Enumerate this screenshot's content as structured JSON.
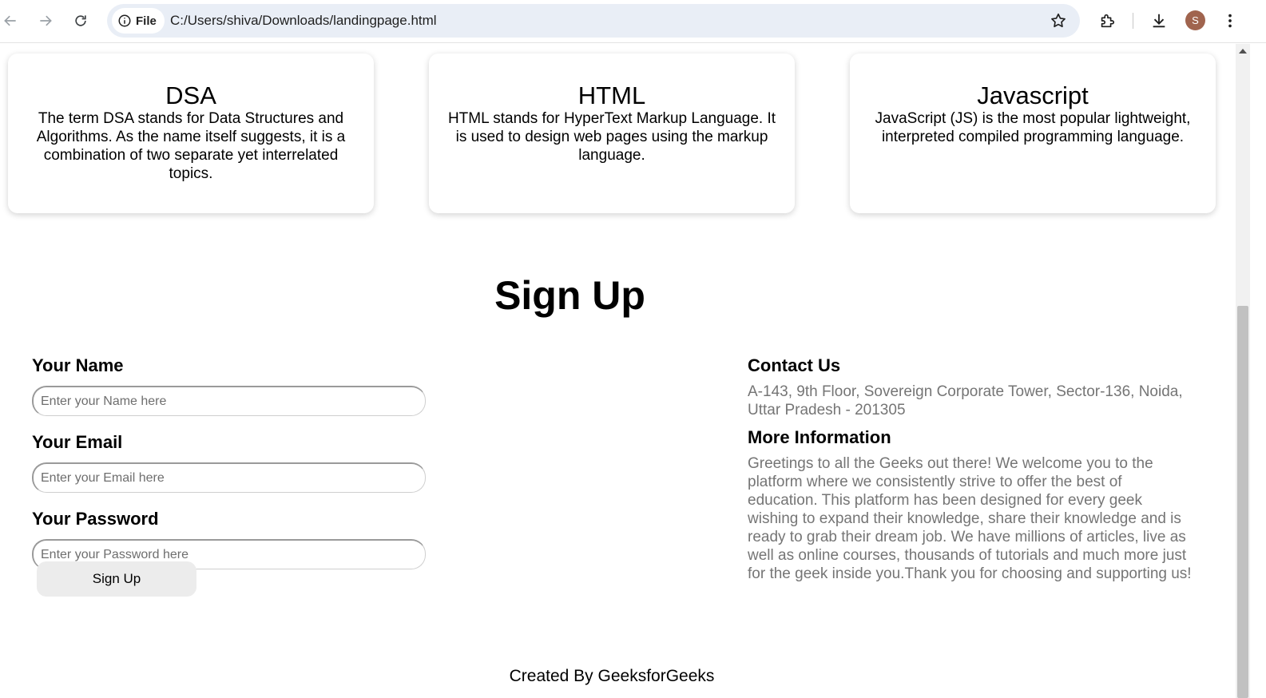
{
  "browser": {
    "site_chip_label": "File",
    "url": "C:/Users/shiva/Downloads/landingpage.html",
    "avatar_letter": "S",
    "avatar_color": "#a0644e"
  },
  "cards": [
    {
      "title": "DSA",
      "text": "The term DSA stands for Data Structures and Algorithms. As the name itself suggests, it is a combination of two separate yet interrelated topics."
    },
    {
      "title": "HTML",
      "text": "HTML stands for HyperText Markup Language. It is used to design web pages using the markup language."
    },
    {
      "title": "Javascript",
      "text": "JavaScript (JS) is the most popular lightweight, interpreted compiled programming language."
    }
  ],
  "signup": {
    "title": "Sign Up",
    "name_label": "Your Name",
    "name_placeholder": "Enter your Name here",
    "email_label": "Your Email",
    "email_placeholder": "Enter your Email here",
    "password_label": "Your Password",
    "password_placeholder": "Enter your Password here",
    "button_label": "Sign Up"
  },
  "contact": {
    "heading": "Contact Us",
    "address": "A-143, 9th Floor, Sovereign Corporate Tower, Sector-136, Noida, Uttar Pradesh - 201305",
    "more_heading": "More Information",
    "more_text": "Greetings to all the Geeks out there! We welcome you to the platform where we consistently strive to offer the best of education. This platform has been designed for every geek wishing to expand their knowledge, share their knowledge and is ready to grab their dream job. We have millions of articles, live as well as online courses, thousands of tutorials and much more just for the geek inside you.Thank you for choosing and supporting us!"
  },
  "footer": {
    "text": "Created By GeeksforGeeks"
  }
}
